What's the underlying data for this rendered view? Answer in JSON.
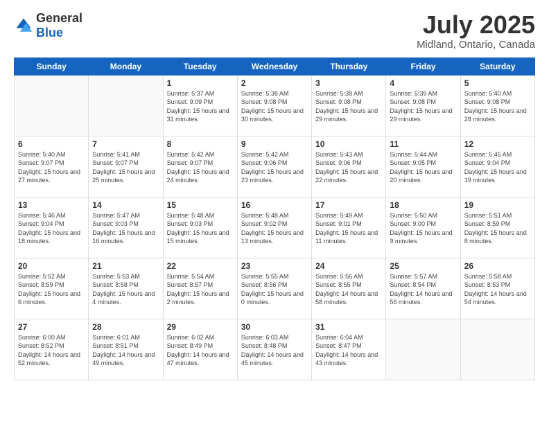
{
  "logo": {
    "general": "General",
    "blue": "Blue"
  },
  "header": {
    "month": "July 2025",
    "location": "Midland, Ontario, Canada"
  },
  "weekdays": [
    "Sunday",
    "Monday",
    "Tuesday",
    "Wednesday",
    "Thursday",
    "Friday",
    "Saturday"
  ],
  "weeks": [
    [
      {
        "day": "",
        "sunrise": "",
        "sunset": "",
        "daylight": ""
      },
      {
        "day": "",
        "sunrise": "",
        "sunset": "",
        "daylight": ""
      },
      {
        "day": "1",
        "sunrise": "Sunrise: 5:37 AM",
        "sunset": "Sunset: 9:09 PM",
        "daylight": "Daylight: 15 hours and 31 minutes."
      },
      {
        "day": "2",
        "sunrise": "Sunrise: 5:38 AM",
        "sunset": "Sunset: 9:08 PM",
        "daylight": "Daylight: 15 hours and 30 minutes."
      },
      {
        "day": "3",
        "sunrise": "Sunrise: 5:38 AM",
        "sunset": "Sunset: 9:08 PM",
        "daylight": "Daylight: 15 hours and 29 minutes."
      },
      {
        "day": "4",
        "sunrise": "Sunrise: 5:39 AM",
        "sunset": "Sunset: 9:08 PM",
        "daylight": "Daylight: 15 hours and 29 minutes."
      },
      {
        "day": "5",
        "sunrise": "Sunrise: 5:40 AM",
        "sunset": "Sunset: 9:08 PM",
        "daylight": "Daylight: 15 hours and 28 minutes."
      }
    ],
    [
      {
        "day": "6",
        "sunrise": "Sunrise: 5:40 AM",
        "sunset": "Sunset: 9:07 PM",
        "daylight": "Daylight: 15 hours and 27 minutes."
      },
      {
        "day": "7",
        "sunrise": "Sunrise: 5:41 AM",
        "sunset": "Sunset: 9:07 PM",
        "daylight": "Daylight: 15 hours and 25 minutes."
      },
      {
        "day": "8",
        "sunrise": "Sunrise: 5:42 AM",
        "sunset": "Sunset: 9:07 PM",
        "daylight": "Daylight: 15 hours and 24 minutes."
      },
      {
        "day": "9",
        "sunrise": "Sunrise: 5:42 AM",
        "sunset": "Sunset: 9:06 PM",
        "daylight": "Daylight: 15 hours and 23 minutes."
      },
      {
        "day": "10",
        "sunrise": "Sunrise: 5:43 AM",
        "sunset": "Sunset: 9:06 PM",
        "daylight": "Daylight: 15 hours and 22 minutes."
      },
      {
        "day": "11",
        "sunrise": "Sunrise: 5:44 AM",
        "sunset": "Sunset: 9:05 PM",
        "daylight": "Daylight: 15 hours and 20 minutes."
      },
      {
        "day": "12",
        "sunrise": "Sunrise: 5:45 AM",
        "sunset": "Sunset: 9:04 PM",
        "daylight": "Daylight: 15 hours and 19 minutes."
      }
    ],
    [
      {
        "day": "13",
        "sunrise": "Sunrise: 5:46 AM",
        "sunset": "Sunset: 9:04 PM",
        "daylight": "Daylight: 15 hours and 18 minutes."
      },
      {
        "day": "14",
        "sunrise": "Sunrise: 5:47 AM",
        "sunset": "Sunset: 9:03 PM",
        "daylight": "Daylight: 15 hours and 16 minutes."
      },
      {
        "day": "15",
        "sunrise": "Sunrise: 5:48 AM",
        "sunset": "Sunset: 9:03 PM",
        "daylight": "Daylight: 15 hours and 15 minutes."
      },
      {
        "day": "16",
        "sunrise": "Sunrise: 5:48 AM",
        "sunset": "Sunset: 9:02 PM",
        "daylight": "Daylight: 15 hours and 13 minutes."
      },
      {
        "day": "17",
        "sunrise": "Sunrise: 5:49 AM",
        "sunset": "Sunset: 9:01 PM",
        "daylight": "Daylight: 15 hours and 11 minutes."
      },
      {
        "day": "18",
        "sunrise": "Sunrise: 5:50 AM",
        "sunset": "Sunset: 9:00 PM",
        "daylight": "Daylight: 15 hours and 9 minutes."
      },
      {
        "day": "19",
        "sunrise": "Sunrise: 5:51 AM",
        "sunset": "Sunset: 8:59 PM",
        "daylight": "Daylight: 15 hours and 8 minutes."
      }
    ],
    [
      {
        "day": "20",
        "sunrise": "Sunrise: 5:52 AM",
        "sunset": "Sunset: 8:59 PM",
        "daylight": "Daylight: 15 hours and 6 minutes."
      },
      {
        "day": "21",
        "sunrise": "Sunrise: 5:53 AM",
        "sunset": "Sunset: 8:58 PM",
        "daylight": "Daylight: 15 hours and 4 minutes."
      },
      {
        "day": "22",
        "sunrise": "Sunrise: 5:54 AM",
        "sunset": "Sunset: 8:57 PM",
        "daylight": "Daylight: 15 hours and 2 minutes."
      },
      {
        "day": "23",
        "sunrise": "Sunrise: 5:55 AM",
        "sunset": "Sunset: 8:56 PM",
        "daylight": "Daylight: 15 hours and 0 minutes."
      },
      {
        "day": "24",
        "sunrise": "Sunrise: 5:56 AM",
        "sunset": "Sunset: 8:55 PM",
        "daylight": "Daylight: 14 hours and 58 minutes."
      },
      {
        "day": "25",
        "sunrise": "Sunrise: 5:57 AM",
        "sunset": "Sunset: 8:54 PM",
        "daylight": "Daylight: 14 hours and 56 minutes."
      },
      {
        "day": "26",
        "sunrise": "Sunrise: 5:58 AM",
        "sunset": "Sunset: 8:53 PM",
        "daylight": "Daylight: 14 hours and 54 minutes."
      }
    ],
    [
      {
        "day": "27",
        "sunrise": "Sunrise: 6:00 AM",
        "sunset": "Sunset: 8:52 PM",
        "daylight": "Daylight: 14 hours and 52 minutes."
      },
      {
        "day": "28",
        "sunrise": "Sunrise: 6:01 AM",
        "sunset": "Sunset: 8:51 PM",
        "daylight": "Daylight: 14 hours and 49 minutes."
      },
      {
        "day": "29",
        "sunrise": "Sunrise: 6:02 AM",
        "sunset": "Sunset: 8:49 PM",
        "daylight": "Daylight: 14 hours and 47 minutes."
      },
      {
        "day": "30",
        "sunrise": "Sunrise: 6:03 AM",
        "sunset": "Sunset: 8:48 PM",
        "daylight": "Daylight: 14 hours and 45 minutes."
      },
      {
        "day": "31",
        "sunrise": "Sunrise: 6:04 AM",
        "sunset": "Sunset: 8:47 PM",
        "daylight": "Daylight: 14 hours and 43 minutes."
      },
      {
        "day": "",
        "sunrise": "",
        "sunset": "",
        "daylight": ""
      },
      {
        "day": "",
        "sunrise": "",
        "sunset": "",
        "daylight": ""
      }
    ]
  ]
}
